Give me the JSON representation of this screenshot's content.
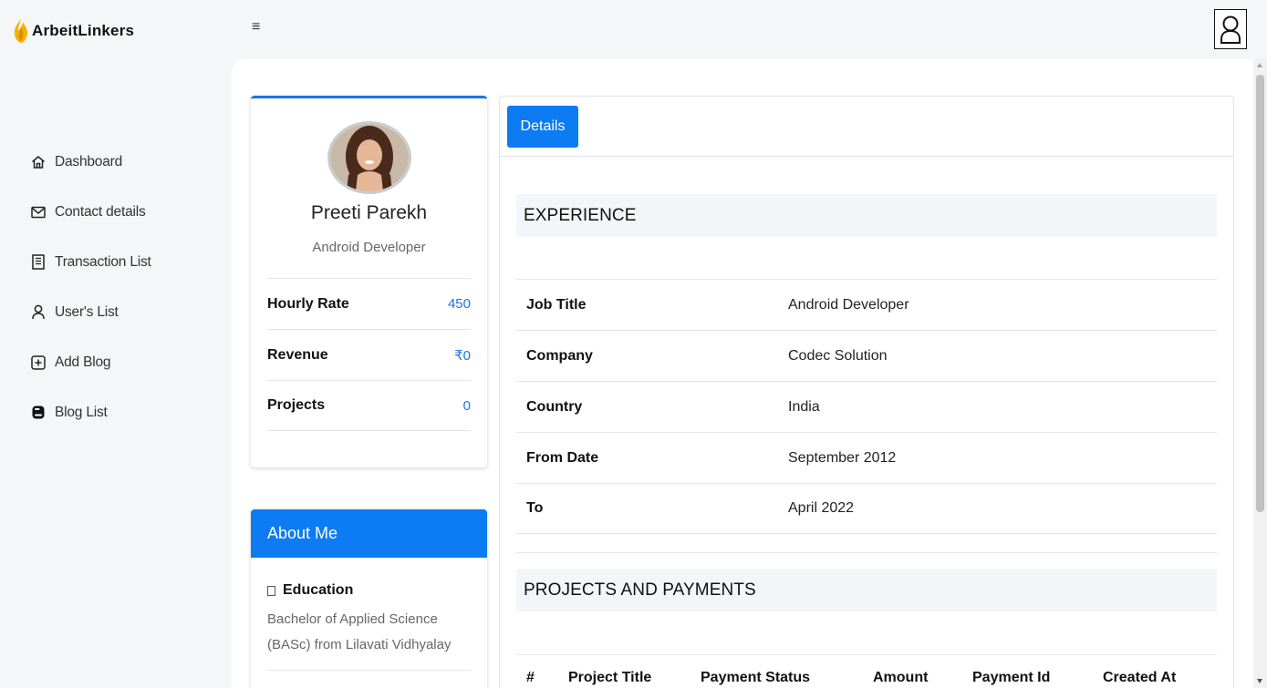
{
  "app": {
    "name": "ArbeitLinkers",
    "brand_color": "#f5b301",
    "accent_color": "#0d7bf2"
  },
  "topbar": {
    "menu_icon": "hamburger-icon",
    "user_icon": "user-icon"
  },
  "sidebar": {
    "items": [
      {
        "label": "Dashboard",
        "icon": "home-icon"
      },
      {
        "label": "Contact details",
        "icon": "envelope-icon"
      },
      {
        "label": "Transaction List",
        "icon": "document-icon"
      },
      {
        "label": "User's List",
        "icon": "user-icon"
      },
      {
        "label": "Add Blog",
        "icon": "plus-square-icon"
      },
      {
        "label": "Blog List",
        "icon": "blogger-icon"
      }
    ]
  },
  "profile": {
    "name": "Preeti Parekh",
    "role": "Android Developer",
    "stats": [
      {
        "label": "Hourly Rate",
        "value": "450"
      },
      {
        "label": "Revenue",
        "value": "₹0"
      },
      {
        "label": "Projects",
        "value": "0"
      }
    ]
  },
  "about": {
    "title": "About Me",
    "education_label": "Education",
    "education_text": "Bachelor of Applied Science (BASc) from Lilavati Vidhyalay"
  },
  "details": {
    "tab_label": "Details",
    "experience_title": "EXPERIENCE",
    "experience": [
      {
        "key": "Job Title",
        "value": "Android Developer"
      },
      {
        "key": "Company",
        "value": "Codec Solution"
      },
      {
        "key": "Country",
        "value": "India"
      },
      {
        "key": "From Date",
        "value": "September 2012"
      },
      {
        "key": "To",
        "value": "April 2022"
      }
    ],
    "projects_title": "PROJECTS AND PAYMENTS",
    "table_headers": [
      "#",
      "Project Title",
      "Payment Status",
      "Amount",
      "Payment Id",
      "Created At"
    ]
  }
}
